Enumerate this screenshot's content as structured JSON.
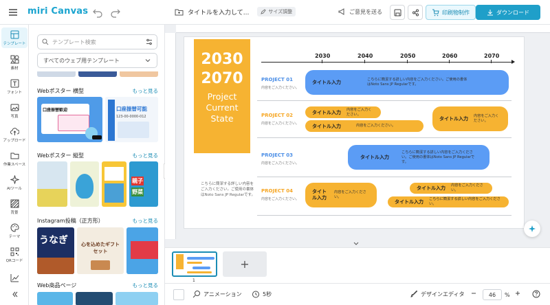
{
  "app": {
    "logo": "miri Canvas"
  },
  "header": {
    "doc_title": "タイトルを入力して...",
    "size_chip": "サイズ調整",
    "feedback": "ご意見を送る",
    "print": "印刷物制作",
    "download": "ダウンロード"
  },
  "rail": [
    {
      "label": "テンプレート"
    },
    {
      "label": "素材"
    },
    {
      "label": "フォント"
    },
    {
      "label": "写真"
    },
    {
      "label": "アップロード"
    },
    {
      "label": "作業スペース"
    },
    {
      "label": "AIツール"
    },
    {
      "label": "背景"
    },
    {
      "label": "テーマ"
    },
    {
      "label": "QRコード"
    }
  ],
  "panel": {
    "search_placeholder": "テンプレート検索",
    "select_value": "すべてのウェブ用テンプレート",
    "sections": [
      {
        "title": "Webポスター 横型",
        "more": "もっと見る"
      },
      {
        "title": "Webポスター 縦型",
        "more": "もっと見る"
      },
      {
        "title": "Instagram投稿（正方形）",
        "more": "もっと見る"
      },
      {
        "title": "Web商品ページ",
        "more": "もっと見る"
      }
    ],
    "thumb_texts": {
      "koza1": "口座振替歓迎",
      "koza2": "口座振替可能",
      "phone": "123-00-0000-012",
      "unagi": "うなぎ",
      "gift": "心を込めたギフトセット",
      "oya": "親子",
      "yasai": "野菜"
    }
  },
  "canvas": {
    "hero_years": [
      "2030",
      "2070"
    ],
    "hero_sub": [
      "Project",
      "Current",
      "State"
    ],
    "note": "こちらに簡潔する詳しい内容をご入力ください。ご使用の書体はNoto Sans JP Regularです。",
    "years": [
      "2030",
      "2040",
      "2050",
      "2060",
      "2070"
    ],
    "projects": [
      {
        "name": "PROJECT 01",
        "sub": "内容をご入力ください。",
        "color": "#5b9cf5"
      },
      {
        "name": "PROJECT 02",
        "sub": "内容をご入力ください。",
        "color": "#f6a623"
      },
      {
        "name": "PROJECT 03",
        "sub": "内容をご入力ください。",
        "color": "#5b9cf5"
      },
      {
        "name": "PROJECT 04",
        "sub": "内容をご入力ください。",
        "color": "#f6a623"
      }
    ],
    "pills": {
      "p1": {
        "title": "タイトル入力",
        "desc": "こちらに簡潔する詳しい内容をご入力ください。ご使用の書体はNoto Sans JP Regularです。"
      },
      "p2a": {
        "title": "タイトル入力",
        "desc": "内容をご入力ください。"
      },
      "p2b": {
        "title": "タイトル入力",
        "desc": "内容をご入力ください。"
      },
      "p2c": {
        "title": "タイトル入力",
        "desc": "内容をご入力ください。"
      },
      "p3": {
        "title": "タイトル入力",
        "desc": "こちらに簡潔する詳しい内容をご入力ください。ご使用の書体はNoto Sans JP Regularです。"
      },
      "p4a": {
        "title": "タイトル入力",
        "desc": "内容をご入力ください。"
      },
      "p4b": {
        "title": "タイトル入力",
        "desc": "内容をご入力ください。"
      },
      "p4c": {
        "title": "タイトル入力",
        "desc": "こちらに簡潔する詳しい内容をご入力ください。"
      }
    }
  },
  "pages": {
    "current": "1",
    "add": "+"
  },
  "bottom": {
    "animation": "アニメーション",
    "duration": "5秒",
    "design_editor": "デザインエディタ",
    "zoom": "46",
    "zoom_unit": "%"
  },
  "colors": {
    "accent": "#1f9fc9",
    "orange": "#f6b332",
    "blue": "#5b9cf5"
  }
}
